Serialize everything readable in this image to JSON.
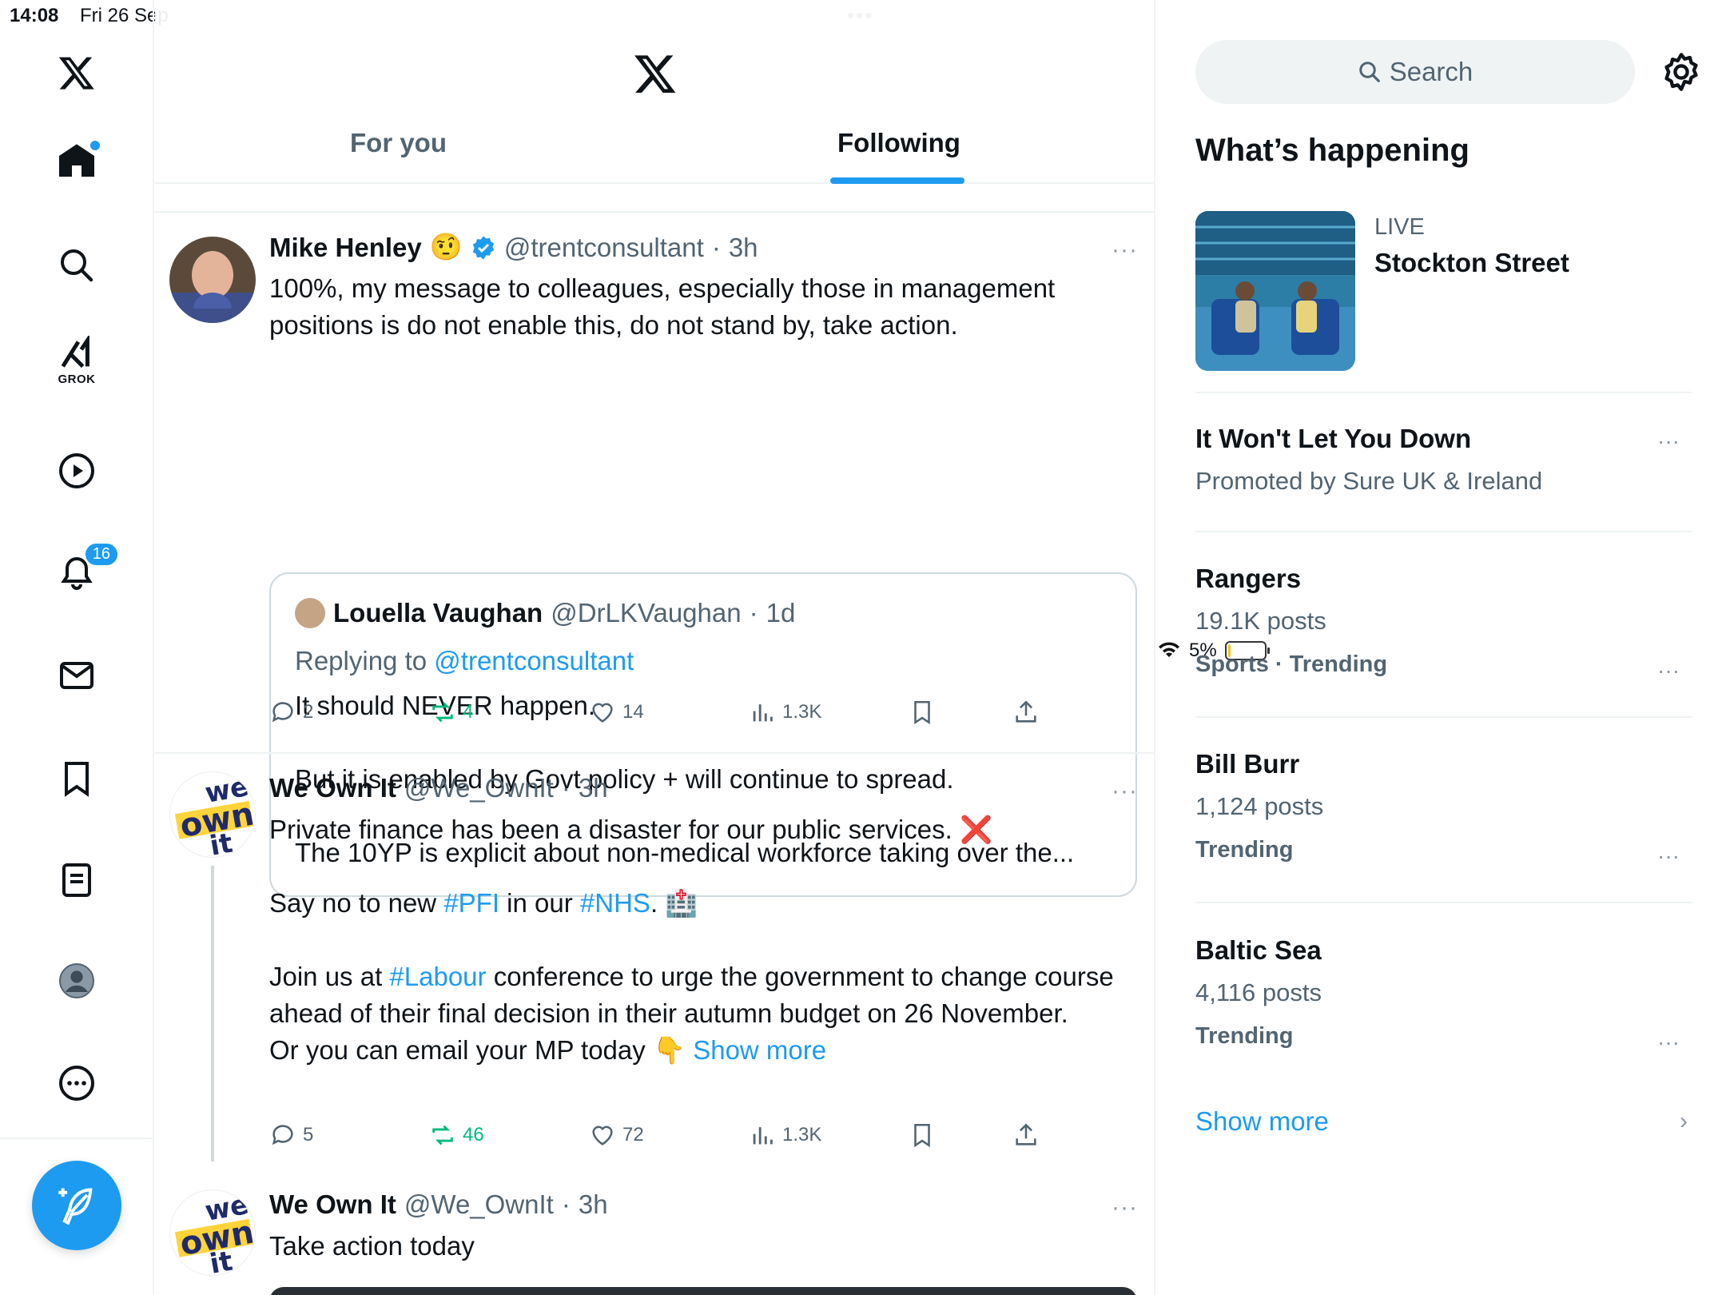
{
  "status_bar": {
    "time": "14:08",
    "date": "Fri 26 Sep",
    "battery": "5%",
    "battery_level": 0.05
  },
  "left_nav": {
    "grok_label": "GROK",
    "notifications_badge": "16",
    "items": [
      "home-icon",
      "search-icon",
      "grok-icon",
      "video-icon",
      "notifications-icon",
      "messages-icon",
      "bookmarks-icon",
      "lists-icon",
      "profile-icon",
      "more-icon"
    ]
  },
  "header": {
    "tabs": [
      {
        "label": "For you",
        "active": false
      },
      {
        "label": "Following",
        "active": true
      }
    ]
  },
  "tweets": [
    {
      "name": "Mike Henley",
      "emoji": "🤨",
      "handle": "@trentconsultant",
      "sep": "·",
      "time": "3h",
      "more": "···",
      "text": "100%, my message to colleagues, especially those in management positions is do not enable this, do not stand by, take action.",
      "quote": {
        "name": "Louella Vaughan",
        "handle": "@DrLKVaughan",
        "sep": "·",
        "time": "1d",
        "replying_prefix": "Replying to",
        "replying_handle": "@trentconsultant",
        "text": "It should NEVER happen.\n\nBut it is enabled by Govt policy + will continue to spread.\n\nThe 10YP is explicit about non-medical workforce taking over the..."
      },
      "actions": {
        "replies": "2",
        "reposts": "4",
        "likes": "14",
        "views": "1.3K"
      }
    },
    {
      "name": "We Own It",
      "avatar_text": [
        "we",
        "own",
        "it"
      ],
      "handle": "@We_OwnIt",
      "sep": "·",
      "time": "3h",
      "more": "···",
      "line1": "Private finance has been a disaster for our public services.",
      "line1_emoji": "❌",
      "line2_a": "Say no to new ",
      "line2_tag1": "#PFI",
      "line2_b": " in our ",
      "line2_tag2": "#NHS",
      "line2_c": ".",
      "line2_emoji": "🏥",
      "line3_a": "Join us at ",
      "line3_tag": "#Labour",
      "line3_b": " conference to urge the government to change course ahead of their final decision in their autumn budget on 26 November.",
      "line4": "Or you can email your MP today",
      "line4_emoji": "👇",
      "show_more": "Show more",
      "actions": {
        "replies": "5",
        "reposts": "46",
        "likes": "72",
        "views": "1.3K"
      }
    },
    {
      "name": "We Own It",
      "avatar_text": [
        "we",
        "own",
        "it"
      ],
      "handle": "@We_OwnIt",
      "sep": "·",
      "time": "3h",
      "more": "···",
      "text": "Take action today"
    }
  ],
  "sidebar": {
    "search_placeholder": "Search",
    "title": "What’s happening",
    "live": {
      "label": "LIVE",
      "title": "Stockton Street"
    },
    "promoted": {
      "title": "It Won't Let You Down",
      "subtitle": "Promoted by Sure UK & Ireland"
    },
    "trends": [
      {
        "name": "Rangers",
        "posts": "19.1K posts",
        "category": "Sports · Trending"
      },
      {
        "name": "Bill Burr",
        "posts": "1,124 posts",
        "category": "Trending"
      },
      {
        "name": "Baltic Sea",
        "posts": "4,116 posts",
        "category": "Trending"
      }
    ],
    "more": "···",
    "show_more": "Show more",
    "chevron": "›"
  },
  "colors": {
    "accent": "#1d9bf0",
    "repost": "#00ba7c",
    "text": "#0f1419",
    "muted": "#536471",
    "border": "#eff3f4"
  }
}
